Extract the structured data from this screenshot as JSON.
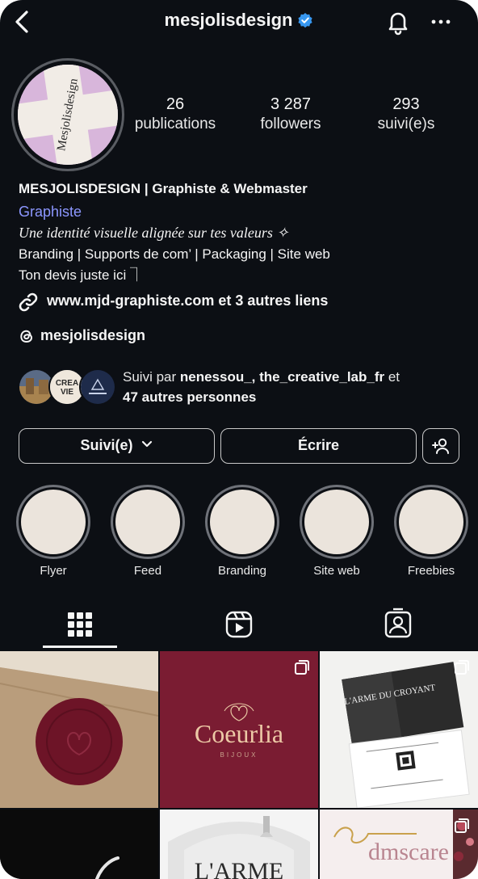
{
  "header": {
    "username": "mesjolisdesign",
    "icons": [
      "back-arrow-icon",
      "verified-badge-icon",
      "bell-icon",
      "more-icon"
    ]
  },
  "profile": {
    "avatar_text": "Mesjolisdesign",
    "stats": [
      {
        "num": "26",
        "label": "publications"
      },
      {
        "num": "3 287",
        "label": "followers"
      },
      {
        "num": "293",
        "label": "suivi(e)s"
      }
    ],
    "name": "MESJOLISDESIGN | Graphiste & Webmaster",
    "category": "Graphiste",
    "tagline": "Une identité visuelle alignée sur tes valeurs ✧",
    "bio_line1": "Branding | Supports de com’ | Packaging | Site web",
    "bio_line2": "Ton devis juste ici ⏋",
    "link": "www.mjd-graphiste.com et 3 autres liens",
    "threads": "mesjolisdesign"
  },
  "followed_by": {
    "prefix": "Suivi par ",
    "names": "nenessou_, the_creative_lab_fr",
    "middle": " et",
    "others": "47 autres personnes",
    "mini_badge": "CREA VIE"
  },
  "buttons": {
    "follow": "Suivi(e)",
    "message": "Écrire"
  },
  "highlights": [
    {
      "label": "Flyer"
    },
    {
      "label": "Feed"
    },
    {
      "label": "Branding"
    },
    {
      "label": "Site web"
    },
    {
      "label": "Freebies"
    }
  ],
  "tabs": [
    "grid-icon",
    "reels-icon",
    "tagged-icon"
  ],
  "posts": [
    {
      "text": ""
    },
    {
      "text": "Coeurlia",
      "sub": "BIJOUX"
    },
    {
      "text": "L'ARME DU CROYANT"
    },
    {
      "text": ""
    },
    {
      "text": "L'ARME"
    },
    {
      "text": "dmscare"
    }
  ],
  "colors": {
    "background": "#0c0f14",
    "category": "#8c97ff",
    "verified": "#3797f0",
    "post_burgundy": "#7a1c32"
  }
}
